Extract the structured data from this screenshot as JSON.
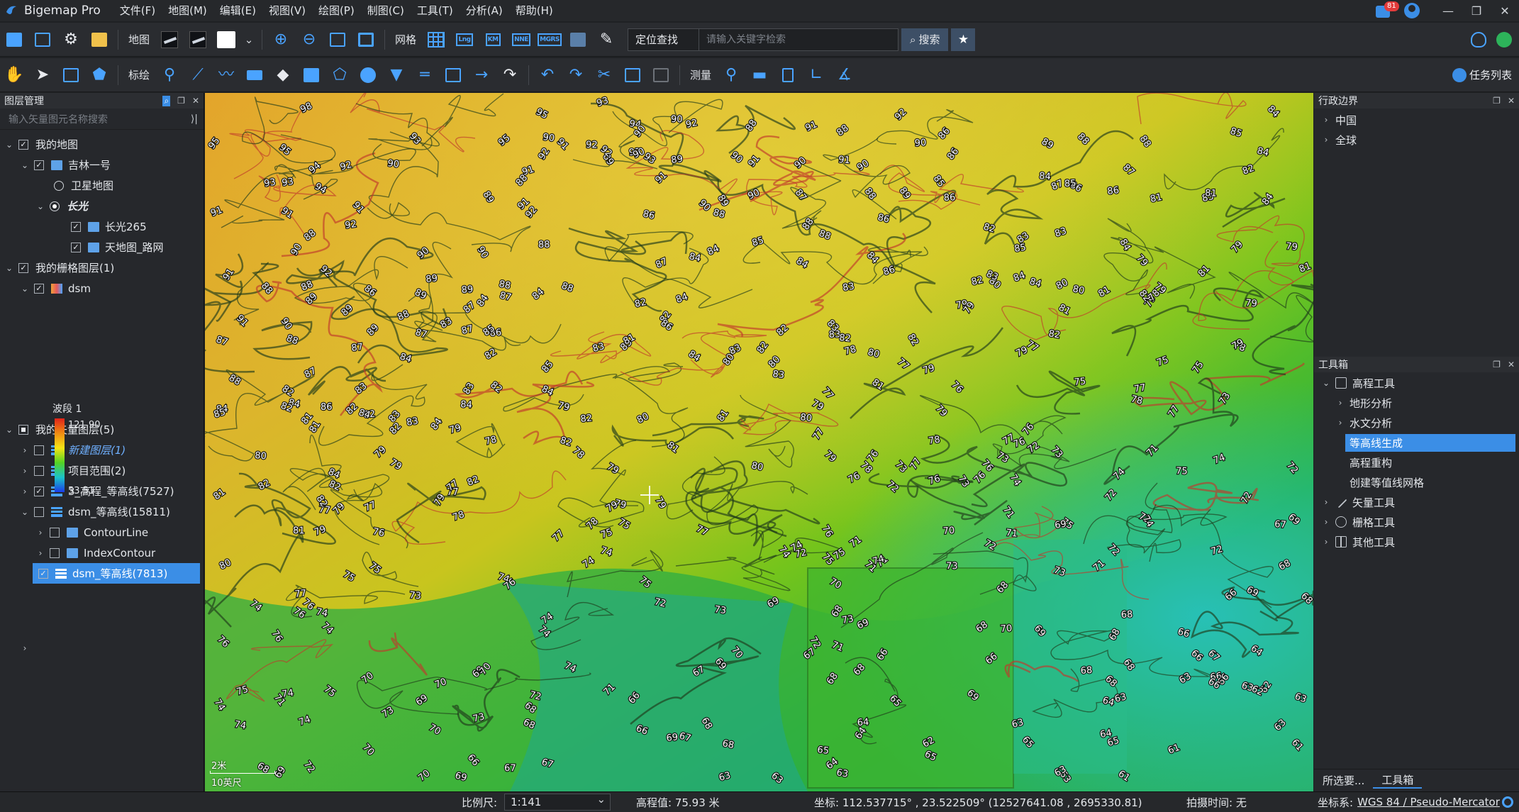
{
  "app": {
    "title": "Bigemap Pro",
    "notification_count": "81"
  },
  "menu": [
    "文件(F)",
    "地图(M)",
    "编辑(E)",
    "视图(V)",
    "绘图(P)",
    "制图(C)",
    "工具(T)",
    "分析(A)",
    "帮助(H)"
  ],
  "toolbar1": {
    "map_label": "地图",
    "grid_label": "网格",
    "locate_mode": "定位查找",
    "search_placeholder": "请输入关键字检索",
    "search_label": "搜索",
    "grid_icons": [
      "Lng",
      "KM",
      "NNE",
      "MGRS"
    ]
  },
  "toolbar2": {
    "draw_label": "标绘",
    "measure_label": "测量",
    "task_list_label": "任务列表"
  },
  "layer_panel": {
    "title": "图层管理",
    "search_placeholder": "输入矢量图元名称搜索",
    "tree": {
      "my_map": "我的地图",
      "jilin": "吉林一号",
      "satellite": "卫星地图",
      "changguang": "长光",
      "changguang265": "长光265",
      "tianditu_road": "天地图_路网",
      "raster_group": "我的栅格图层(1)",
      "dsm": "dsm",
      "vector_group": "我的矢量图层(5)",
      "new_layer": "新建图层(1)",
      "project_range": "项目范围(2)",
      "contour_3": "3_高程_等高线(7527)",
      "dsm_contour_15811": "dsm_等高线(15811)",
      "contour_line": "ContourLine",
      "index_contour": "IndexContour",
      "dsm_contour_7813": "dsm_等高线(7813)"
    },
    "legend": {
      "band": "波段 1",
      "max": "121.90",
      "min": "53.51"
    }
  },
  "admin_panel": {
    "title": "行政边界",
    "items": [
      "中国",
      "全球"
    ]
  },
  "toolbox": {
    "title": "工具箱",
    "elevation_tools": "高程工具",
    "terrain_analysis": "地形分析",
    "hydro_analysis": "水文分析",
    "contour_gen": "等高线生成",
    "elevation_rebuild": "高程重构",
    "contour_grid": "创建等值线网格",
    "vector_tools": "矢量工具",
    "raster_tools": "栅格工具",
    "other_tools": "其他工具"
  },
  "right_tabs": [
    "所选要...",
    "工具箱"
  ],
  "map_view": {
    "scale_top": "2米",
    "scale_bottom": "10英尺",
    "contour_labels": [
      {
        "t": "98"
      },
      {
        "t": "96"
      },
      {
        "t": "95"
      },
      {
        "t": "94"
      },
      {
        "t": "93"
      },
      {
        "t": "92"
      },
      {
        "t": "91"
      },
      {
        "t": "90"
      },
      {
        "t": "89"
      },
      {
        "t": "88"
      },
      {
        "t": "87"
      },
      {
        "t": "86"
      },
      {
        "t": "85"
      },
      {
        "t": "84"
      },
      {
        "t": "83"
      },
      {
        "t": "82"
      },
      {
        "t": "81"
      },
      {
        "t": "80"
      },
      {
        "t": "79"
      },
      {
        "t": "78"
      },
      {
        "t": "77"
      },
      {
        "t": "76"
      },
      {
        "t": "75"
      },
      {
        "t": "74"
      },
      {
        "t": "73"
      },
      {
        "t": "72"
      },
      {
        "t": "71"
      },
      {
        "t": "70"
      },
      {
        "t": "69"
      },
      {
        "t": "68"
      },
      {
        "t": "67"
      },
      {
        "t": "66"
      },
      {
        "t": "65"
      },
      {
        "t": "64"
      },
      {
        "t": "63"
      },
      {
        "t": "62"
      },
      {
        "t": "61"
      }
    ]
  },
  "status": {
    "scale_label": "比例尺:",
    "scale_value": "1:141",
    "elevation": "高程值: 75.93 米",
    "coordinates": "坐标:  112.537715° , 23.522509°   (12527641.08 , 2695330.81)",
    "capture_time": "拍摄时间: 无",
    "crs_label": "坐标系:",
    "crs_value": "WGS 84 / Pseudo-Mercator"
  },
  "colors": {
    "accent": "#3b8ee6",
    "icon_blue": "#4aa3ff"
  }
}
